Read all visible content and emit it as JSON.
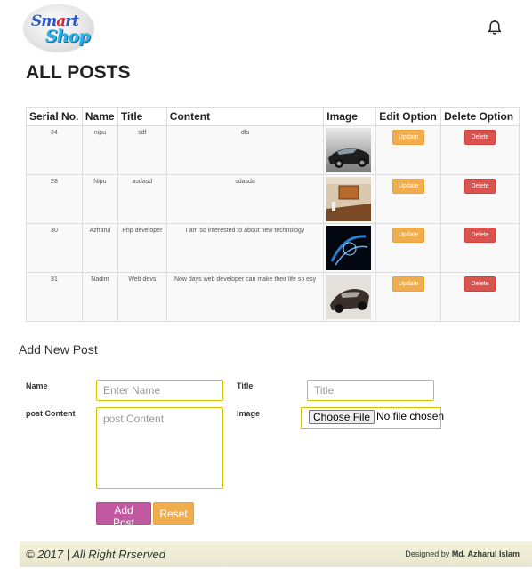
{
  "header": {
    "logo_text_line1_a": "Sm",
    "logo_text_line1_b": "a",
    "logo_text_line1_c": "rt",
    "logo_text_line2": "Shop",
    "notification_icon": "bell-icon"
  },
  "page_title": "ALL POSTS",
  "table": {
    "headers": [
      "Serial No.",
      "Name",
      "Title",
      "Content",
      "Image",
      "Edit Option",
      "Delete Option"
    ],
    "update_label": "Update",
    "delete_label": "Delete",
    "rows": [
      {
        "serial": "24",
        "name": "nipu",
        "title": "sdf",
        "content": "dfs",
        "image": "car-silver"
      },
      {
        "serial": "28",
        "name": "Nipu",
        "title": "asdasd",
        "content": "sdasda",
        "image": "room-interior"
      },
      {
        "serial": "30",
        "name": "Azharul",
        "title": "Php developer",
        "content": "I am so interested to about new technology",
        "image": "abstract-blue"
      },
      {
        "serial": "31",
        "name": "Nadim",
        "title": "Web devs",
        "content": "Now days web developer can make their life so esy",
        "image": "car-dark"
      }
    ]
  },
  "form": {
    "section_title": "Add New Post",
    "name_label": "Name",
    "name_placeholder": "Enter Name",
    "title_label": "Title",
    "title_placeholder": "Title",
    "content_label": "post Content",
    "content_placeholder": "post Content",
    "image_label": "Image",
    "file_button": "Choose File",
    "file_status": "No file chosen",
    "add_button": "Add Post",
    "reset_button": "Reset"
  },
  "footer": {
    "copyright": "© 2017 | All Right Rrserved",
    "designed_prefix": "Designed by",
    "designer": "Md. Azharul Islam"
  },
  "colors": {
    "update": "#f0ad4e",
    "delete": "#d9534f",
    "add_post": "#c0599f",
    "input_border": "#d4c400",
    "footer_bg": "#f4f2d9"
  }
}
